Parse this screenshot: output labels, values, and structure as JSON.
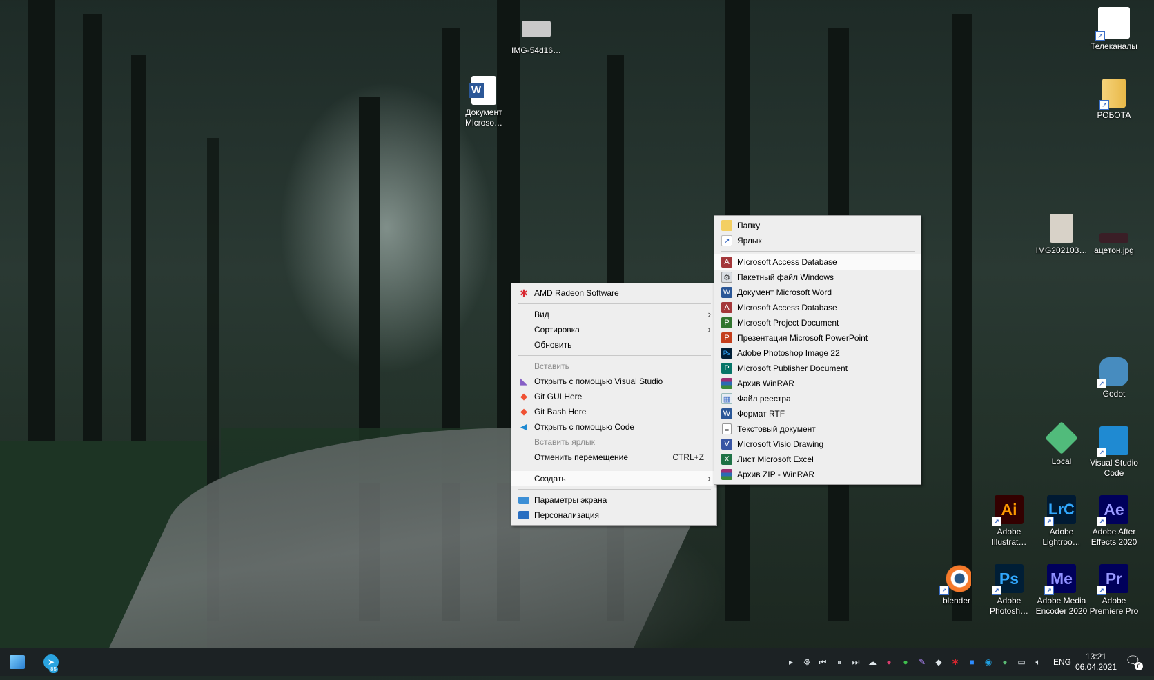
{
  "desktop": {
    "icons": [
      {
        "label": "IMG-54d16…"
      },
      {
        "label": "Документ Microso…"
      },
      {
        "label": "Телеканалы"
      },
      {
        "label": "РОБОТА"
      },
      {
        "label": "IMG202103…"
      },
      {
        "label": "ацетон.jpg"
      },
      {
        "label": "Godot"
      },
      {
        "label": "Local"
      },
      {
        "label": "Visual Studio Code"
      },
      {
        "label": "Adobe Illustrat…",
        "glyph": "Ai"
      },
      {
        "label": "Adobe Lightroo…",
        "glyph": "LrC"
      },
      {
        "label": "Adobe After Effects 2020",
        "glyph": "Ae"
      },
      {
        "label": "blender"
      },
      {
        "label": "Adobe Photosh…",
        "glyph": "Ps"
      },
      {
        "label": "Adobe Media Encoder 2020",
        "glyph": "Me"
      },
      {
        "label": "Adobe Premiere Pro",
        "glyph": "Pr"
      }
    ]
  },
  "context_menu": {
    "items": [
      {
        "label": "AMD Radeon Software",
        "icon": "amd-icon"
      },
      {
        "label": "Вид",
        "submenu": true
      },
      {
        "label": "Сортировка",
        "submenu": true
      },
      {
        "label": "Обновить"
      },
      {
        "label": "Вставить",
        "disabled": true
      },
      {
        "label": "Открыть с помощью Visual Studio",
        "icon": "visual-studio-icon"
      },
      {
        "label": "Git GUI Here",
        "icon": "git-icon"
      },
      {
        "label": "Git Bash Here",
        "icon": "git-icon"
      },
      {
        "label": "Открыть с помощью Code",
        "icon": "vscode-icon"
      },
      {
        "label": "Вставить ярлык",
        "disabled": true
      },
      {
        "label": "Отменить перемещение",
        "shortcut": "CTRL+Z"
      },
      {
        "label": "Создать",
        "submenu": true
      },
      {
        "label": "Параметры экрана",
        "icon": "display-icon"
      },
      {
        "label": "Персонализация",
        "icon": "personalize-icon"
      }
    ]
  },
  "create_submenu": {
    "items": [
      {
        "label": "Папку",
        "icon": "folder-icon"
      },
      {
        "label": "Ярлык",
        "icon": "shortcut-icon"
      },
      {
        "label": "Microsoft Access Database",
        "icon": "access-icon"
      },
      {
        "label": "Пакетный файл Windows",
        "icon": "batch-file-icon"
      },
      {
        "label": "Документ Microsoft Word",
        "icon": "word-icon"
      },
      {
        "label": "Microsoft Access Database",
        "icon": "access-icon"
      },
      {
        "label": "Microsoft Project Document",
        "icon": "project-icon"
      },
      {
        "label": "Презентация Microsoft PowerPoint",
        "icon": "powerpoint-icon"
      },
      {
        "label": "Adobe Photoshop Image 22",
        "icon": "photoshop-icon"
      },
      {
        "label": "Microsoft Publisher Document",
        "icon": "publisher-icon"
      },
      {
        "label": "Архив WinRAR",
        "icon": "winrar-icon"
      },
      {
        "label": "Файл реестра",
        "icon": "registry-icon"
      },
      {
        "label": "Формат RTF",
        "icon": "rtf-icon"
      },
      {
        "label": "Текстовый документ",
        "icon": "text-document-icon"
      },
      {
        "label": "Microsoft Visio Drawing",
        "icon": "visio-icon"
      },
      {
        "label": "Лист Microsoft Excel",
        "icon": "excel-icon"
      },
      {
        "label": "Архив ZIP - WinRAR",
        "icon": "winrar-icon"
      }
    ]
  },
  "taskbar": {
    "telegram_badge": "85",
    "language": "ENG",
    "time": "13:21",
    "date": "06.04.2021",
    "notification_count": "6"
  }
}
